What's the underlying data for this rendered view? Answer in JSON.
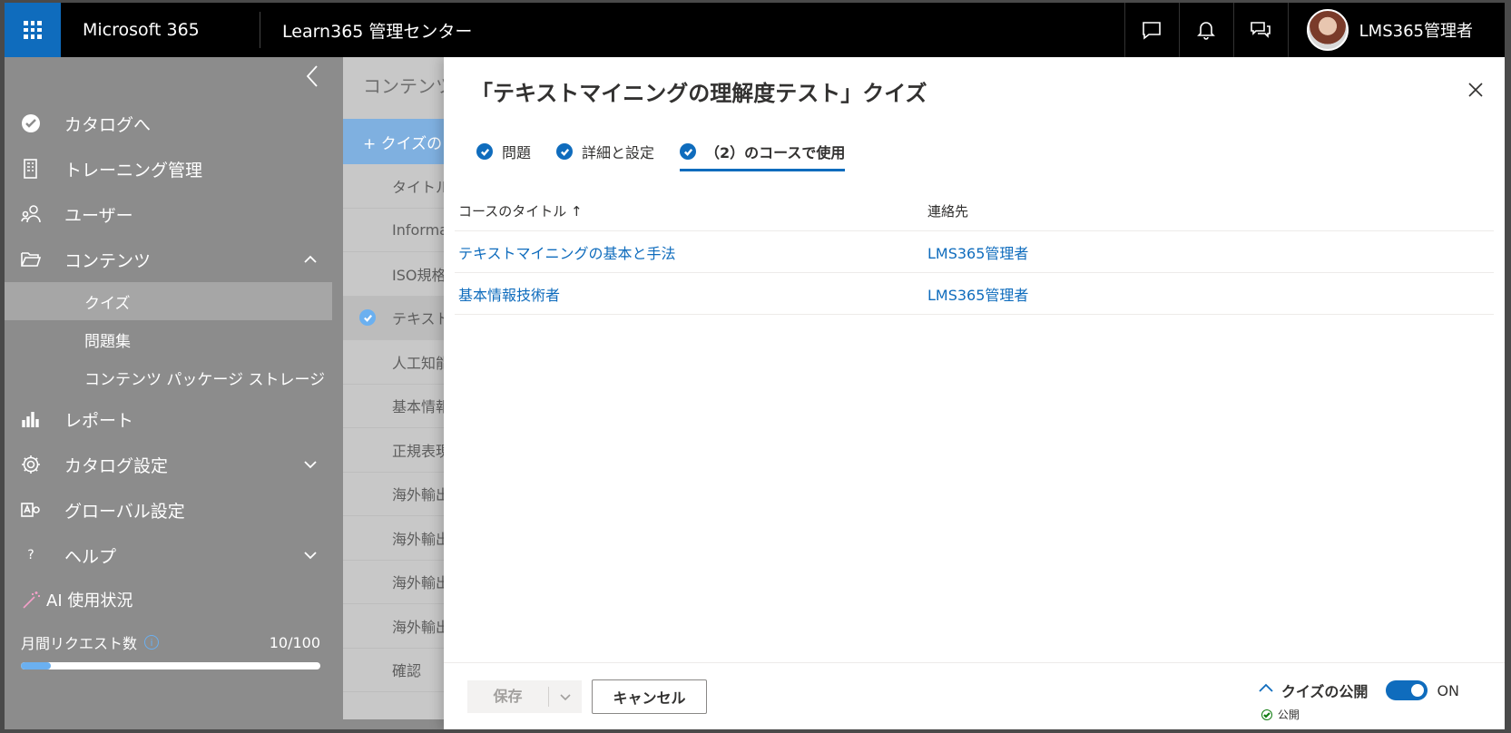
{
  "topbar": {
    "brand": "Microsoft 365",
    "app_title": "Learn365 管理センター",
    "user_name": "LMS365管理者"
  },
  "sidebar": {
    "items": [
      {
        "label": "カタログへ",
        "icon": "catalog-check-icon"
      },
      {
        "label": "トレーニング管理",
        "icon": "building-icon"
      },
      {
        "label": "ユーザー",
        "icon": "users-icon"
      },
      {
        "label": "コンテンツ",
        "icon": "folder-open-icon"
      }
    ],
    "content_sub": [
      "クイズ",
      "問題集",
      "コンテンツ パッケージ ストレージ"
    ],
    "items_after": [
      {
        "label": "レポート",
        "icon": "bar-chart-icon"
      },
      {
        "label": "カタログ設定",
        "icon": "gear-icon"
      },
      {
        "label": "グローバル設定",
        "icon": "admin-icon"
      },
      {
        "label": "ヘルプ",
        "icon": "question-icon"
      }
    ],
    "ai_title": "AI 使用状況",
    "monthly_requests_label": "月間リクエスト数",
    "monthly_requests_count": "10/100",
    "monthly_requests_fraction": 0.1
  },
  "behind": {
    "title": "コンテンツ",
    "add_button": "+ クイズの",
    "rows": [
      "タイトル",
      "Informat",
      "ISO規格",
      "テキスト",
      "人工知能",
      "基本情報",
      "正規表現",
      "海外輸出",
      "海外輸出",
      "海外輸出",
      "海外輸出",
      "確認"
    ]
  },
  "panel": {
    "title": "「テキストマイニングの理解度テスト」クイズ",
    "tabs": [
      "問題",
      "詳細と設定",
      "（2）のコースで使用"
    ],
    "table": {
      "col_title": "コースのタイトル ↑",
      "col_contact": "連絡先",
      "rows": [
        {
          "title": "テキストマイニングの基本と手法",
          "contact": "LMS365管理者"
        },
        {
          "title": "基本情報技術者",
          "contact": "LMS365管理者"
        }
      ]
    },
    "footer": {
      "save": "保存",
      "cancel": "キャンセル",
      "publish_label": "クイズの公開",
      "toggle_state": "ON",
      "publish_status": "公開"
    }
  }
}
